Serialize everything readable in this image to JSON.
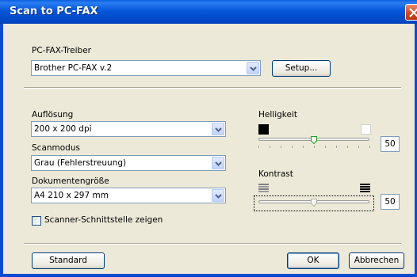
{
  "window": {
    "title": "Scan to PC-FAX"
  },
  "driver": {
    "label": "PC-FAX-Treiber",
    "value": "Brother PC-FAX v.2",
    "setup_label": "Setup..."
  },
  "resolution": {
    "label": "Auflösung",
    "value": "200 x 200 dpi"
  },
  "scanmode": {
    "label": "Scanmodus",
    "value": "Grau (Fehlerstreuung)"
  },
  "docsize": {
    "label": "Dokumentengröße",
    "value": "A4 210 x 297 mm"
  },
  "scanner_interface": {
    "label": "Scanner-Schnittstelle zeigen",
    "checked": false
  },
  "brightness": {
    "label": "Helligkeit",
    "value": "50",
    "level": 0.5
  },
  "contrast": {
    "label": "Kontrast",
    "value": "50",
    "level": 0.5
  },
  "footer": {
    "standard_label": "Standard",
    "ok_label": "OK",
    "cancel_label": "Abbrechen"
  },
  "colors": {
    "titlebar": "#0248c8",
    "dialog_bg": "#ece9d8",
    "thumb_accent": "#21a121"
  },
  "icons": {
    "close": "close-icon",
    "dropdown": "chevron-down-icon",
    "dark": "black-square-icon",
    "light": "white-square-icon",
    "contrast_low": "low-contrast-lines-icon",
    "contrast_high": "high-contrast-lines-icon"
  }
}
